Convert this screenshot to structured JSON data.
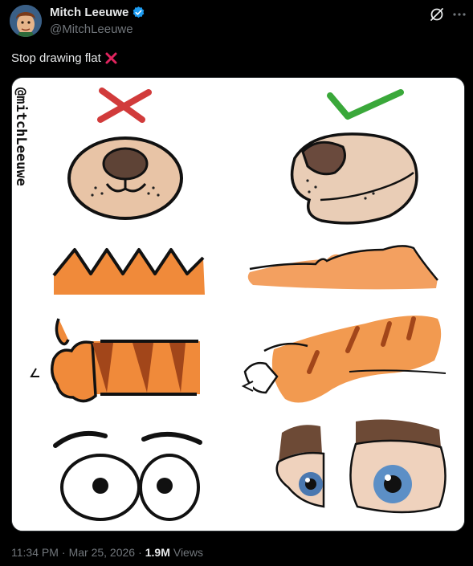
{
  "author": {
    "display_name": "Mitch Leeuwe",
    "handle": "@MitchLeeuwe",
    "verified": true
  },
  "post": {
    "text": "Stop drawing flat",
    "text_emoji": "cross-mark-emoji"
  },
  "media": {
    "watermark": "@mitchLeeuwe",
    "description_icons": {
      "wrong": "red-cross-mark",
      "right": "green-check-mark"
    }
  },
  "meta": {
    "time": "11:34 PM",
    "separator1": "·",
    "date": "Mar 25, 2026",
    "separator2": "·",
    "views_count": "1.9M",
    "views_label": "Views"
  },
  "colors": {
    "background": "#000000",
    "text_primary": "#e7e9ea",
    "text_secondary": "#71767b",
    "verified_blue": "#1d9bf0",
    "wrong_red": "#d13b3b",
    "right_green": "#3aa83a",
    "orange": "#f08a3a"
  }
}
